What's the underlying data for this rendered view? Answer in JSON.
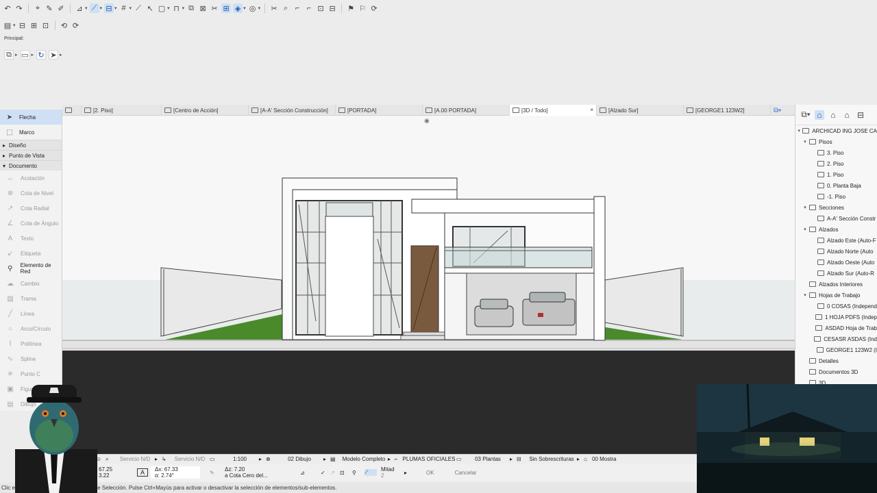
{
  "toolbar": {
    "principal_label": "Principal:"
  },
  "tabs": [
    {
      "label": "[2. Piso]"
    },
    {
      "label": "[Centro de Acción]"
    },
    {
      "label": "[A-A' Sección Construcción]"
    },
    {
      "label": "[PORTADA]"
    },
    {
      "label": "[A.00 PORTADA]"
    },
    {
      "label": "[3D / Todo]",
      "close": "×"
    },
    {
      "label": "[Alzado Sur]"
    },
    {
      "label": "[GEORGE1 123W2]"
    }
  ],
  "left_palette": {
    "arrow_tool": "Flecha",
    "marquee_tool": "Marco",
    "groups": [
      "Diseño",
      "Punto de Vista",
      "Documento"
    ],
    "tools": [
      {
        "label": "Acotación",
        "icon": "dimension-icon",
        "enabled": false
      },
      {
        "label": "Cota de Nivel",
        "icon": "level-dimension-icon",
        "enabled": false
      },
      {
        "label": "Cota Radial",
        "icon": "radial-dimension-icon",
        "enabled": false
      },
      {
        "label": "Cota de Ángulo",
        "icon": "angle-dimension-icon",
        "enabled": false
      },
      {
        "label": "Texto",
        "icon": "text-icon",
        "enabled": false
      },
      {
        "label": "Etiqueta",
        "icon": "label-icon",
        "enabled": false
      },
      {
        "label": "Elemento de Red",
        "icon": "grid-element-icon",
        "enabled": true
      },
      {
        "label": "Cambio",
        "icon": "change-icon",
        "enabled": false
      },
      {
        "label": "Trama",
        "icon": "fill-icon",
        "enabled": false
      },
      {
        "label": "Línea",
        "icon": "line-icon",
        "enabled": false
      },
      {
        "label": "Arco/Círculo",
        "icon": "arc-icon",
        "enabled": false
      },
      {
        "label": "Polilínea",
        "icon": "polyline-icon",
        "enabled": false
      },
      {
        "label": "Spline",
        "icon": "spline-icon",
        "enabled": false
      },
      {
        "label": "Punto C",
        "icon": "hotspot-icon",
        "enabled": false
      },
      {
        "label": "Figura",
        "icon": "figure-icon",
        "enabled": false
      },
      {
        "label": "Dibujo",
        "icon": "drawing-icon",
        "enabled": false
      }
    ]
  },
  "navigator": {
    "root": "ARCHICAD ING JOSE CA",
    "items": [
      {
        "label": "Pisos",
        "level": 1,
        "expanded": true
      },
      {
        "label": "3. Piso",
        "level": 2
      },
      {
        "label": "2. Piso",
        "level": 2
      },
      {
        "label": "1. Piso",
        "level": 2
      },
      {
        "label": "0. Planta Baja",
        "level": 2
      },
      {
        "label": "-1. Piso",
        "level": 2
      },
      {
        "label": "Secciones",
        "level": 1,
        "expanded": true
      },
      {
        "label": "A-A' Sección Constr",
        "level": 2
      },
      {
        "label": "Alzados",
        "level": 1,
        "expanded": true
      },
      {
        "label": "Alzado Este (Auto-F",
        "level": 2
      },
      {
        "label": "Alzado Norte (Auto",
        "level": 2
      },
      {
        "label": "Alzado Oeste (Auto",
        "level": 2
      },
      {
        "label": "Alzado Sur (Auto-R",
        "level": 2
      },
      {
        "label": "Alzados Interiores",
        "level": 1
      },
      {
        "label": "Hojas de Trabajo",
        "level": 1,
        "expanded": true
      },
      {
        "label": "0 COSAS (Independ",
        "level": 2
      },
      {
        "label": "1 HOJA PDFS (Indep",
        "level": 2
      },
      {
        "label": "ASDAD Hoja de Trab",
        "level": 2
      },
      {
        "label": "CESASR ASDAS (Ind",
        "level": 2
      },
      {
        "label": "GEORGE1 123W2 (I",
        "level": 2
      },
      {
        "label": "Detalles",
        "level": 1
      },
      {
        "label": "Documentos 3D",
        "level": 1
      },
      {
        "label": "3D",
        "level": 1
      }
    ]
  },
  "status_row": {
    "servicio1": "Servicio N/D",
    "servicio2": "Servicio N/D",
    "scale": "1:100",
    "layer": "02 Dibujo",
    "model": "Modelo Completo",
    "pens": "PLUMAS OFICIALES",
    "plants": "03 Plantas",
    "override": "Sin Sobrescrituras",
    "show": "00 Mostra"
  },
  "coords": {
    "x": "67.25",
    "y": "3.22",
    "dx": "Δx: 67.33",
    "angle": "α: 2.74°",
    "dz": "Δz: 7.20",
    "ref": "a Cota Cero del...",
    "half": "Mitad",
    "half_num": "2",
    "ok": "OK",
    "cancel": "Cancelar"
  },
  "status_bar": "Clic en un Elemento o Dibuje un Área de Selección. Pulse Ctrl+Mayús para activar o desactivar la selección de elementos/sub-elementos.",
  "colors": {
    "accent": "#cfe0f5",
    "viewport_bg": "#f6f6f6",
    "grass": "#4a8a2a",
    "ground_dark": "#2b2b2b"
  }
}
